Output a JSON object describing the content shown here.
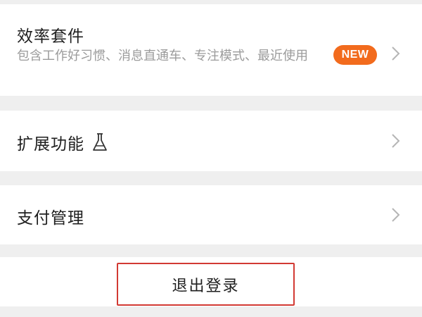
{
  "efficiency_suite": {
    "title": "效率套件",
    "description": "包含工作好习惯、消息直通车、专注模式、最近使用",
    "badge": "NEW",
    "badge_color": "#f26b1d",
    "icon": "chevron-right-icon"
  },
  "extensions": {
    "title": "扩展功能",
    "title_icon": "flask-icon",
    "icon": "chevron-right-icon"
  },
  "payment": {
    "title": "支付管理",
    "icon": "chevron-right-icon"
  },
  "logout": {
    "label": "退出登录",
    "border_color": "#d23a33"
  }
}
